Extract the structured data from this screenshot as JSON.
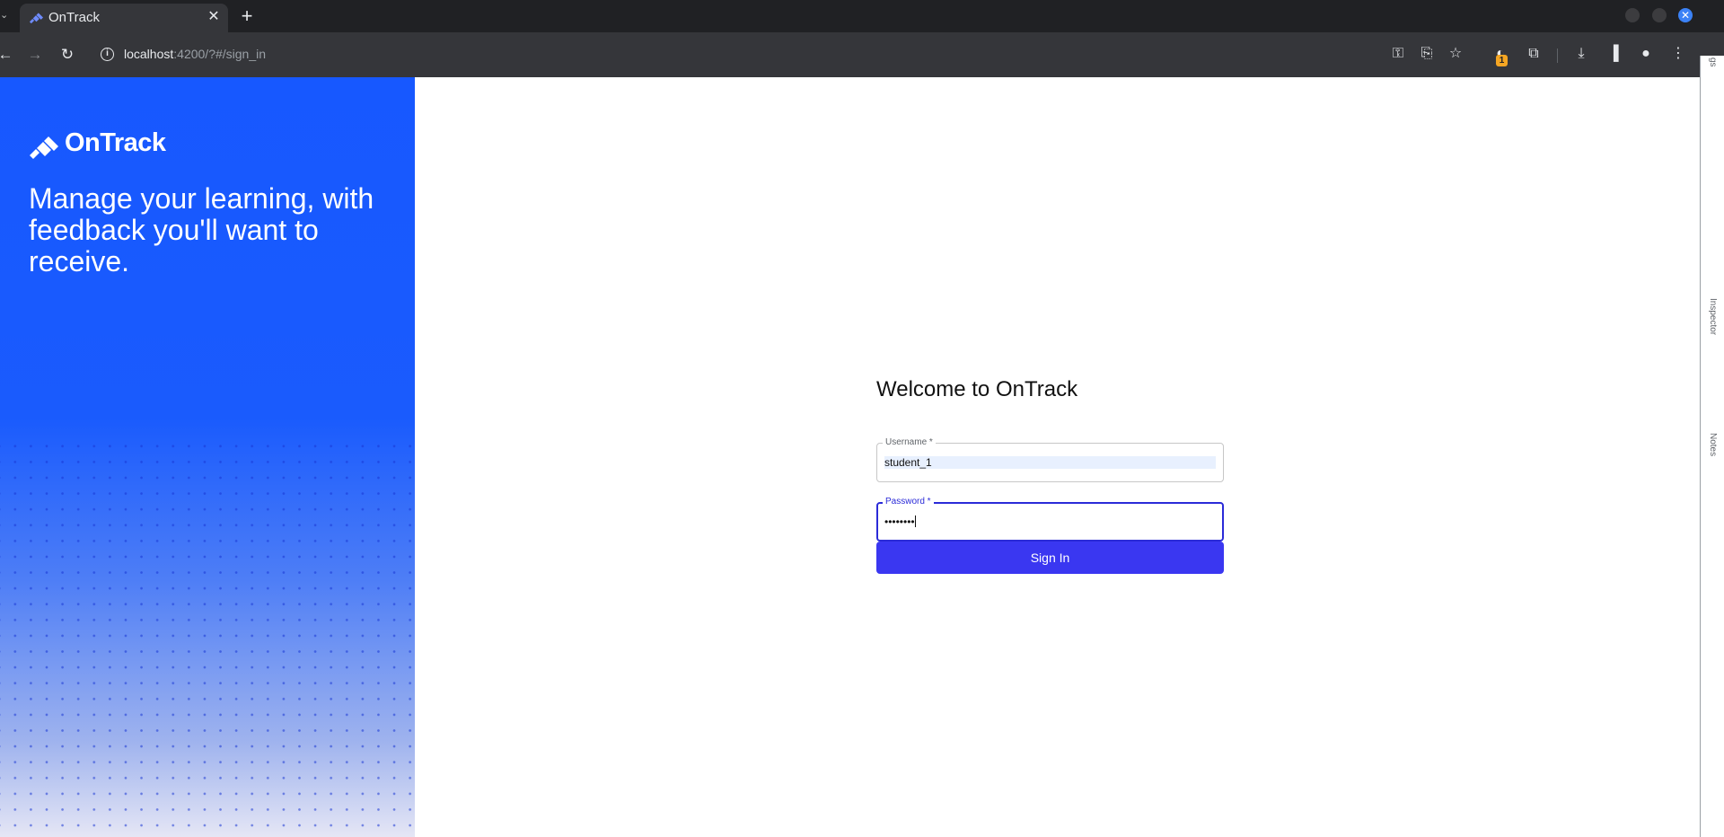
{
  "browser": {
    "tab": {
      "title": "OnTrack"
    },
    "url": {
      "host": "localhost",
      "path": ":4200/?#/sign_in"
    },
    "extension_badge": "1"
  },
  "hero": {
    "brand": "OnTrack",
    "tagline": "Manage your learning, with feedback you'll want to receive."
  },
  "signin": {
    "heading": "Welcome to OnTrack",
    "username": {
      "label": "Username *",
      "value": "student_1"
    },
    "password": {
      "label": "Password *",
      "masked_value": "••••••••"
    },
    "button_label": "Sign In"
  },
  "devtools_sidebar": {
    "labels": [
      "gs",
      "Inspector",
      "Notes"
    ]
  },
  "colors": {
    "brand_blue": "#1758ff",
    "primary_button": "#3a37f1",
    "focus_border": "#2b2bd8"
  }
}
